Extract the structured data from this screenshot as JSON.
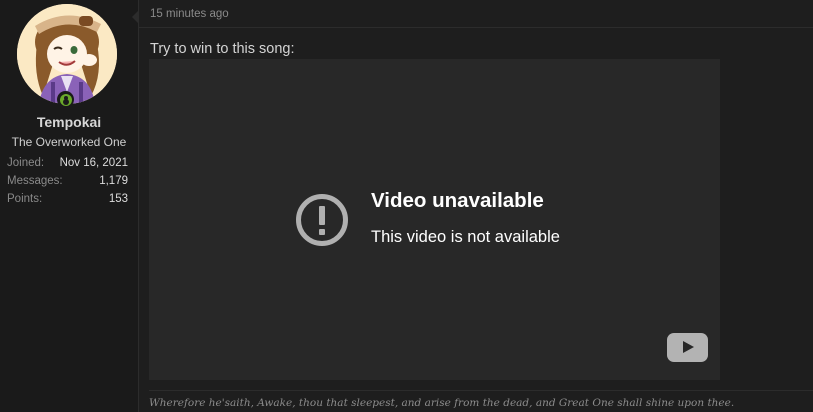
{
  "user": {
    "username": "Tempokai",
    "title": "The Overworked One",
    "online_status": "online",
    "stats": [
      {
        "label": "Joined:",
        "value": "Nov 16, 2021"
      },
      {
        "label": "Messages:",
        "value": "1,179"
      },
      {
        "label": "Points:",
        "value": "153"
      }
    ]
  },
  "post": {
    "timestamp": "15 minutes ago",
    "text": "Try to win to this song:",
    "embed": {
      "title": "Video unavailable",
      "subtitle": "This video is not available",
      "icon": "exclamation-circle-icon",
      "brand_icon": "youtube-icon"
    },
    "signature": "Wherefore he'saith, Awake, thou that sleepest, and arise from the dead, and Great One shall shine upon thee."
  },
  "colors": {
    "background": "#1e1e1e",
    "sidebar": "#1a1a1a",
    "video_bg": "#282828",
    "online": "#6aa92a"
  }
}
